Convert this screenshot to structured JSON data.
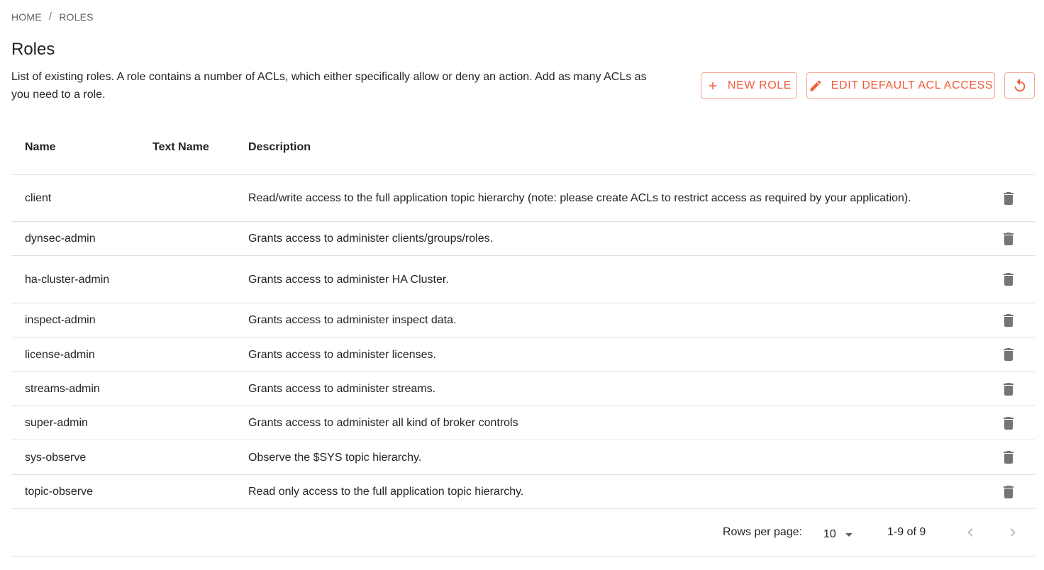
{
  "breadcrumb": {
    "home": "HOME",
    "separator": "/",
    "current": "ROLES"
  },
  "page": {
    "title": "Roles",
    "description": "List of existing roles. A role contains a number of ACLs, which either specifically allow or deny an action. Add as many ACLs as you need to a role."
  },
  "toolbar": {
    "new_role_label": "NEW ROLE",
    "edit_default_acl_label": "EDIT DEFAULT ACL ACCESS",
    "accent_color": "#f45b39"
  },
  "table": {
    "headers": {
      "name": "Name",
      "text_name": "Text Name",
      "description": "Description"
    },
    "rows": [
      {
        "name": "client",
        "text_name": "",
        "description": "Read/write access to the full application topic hierarchy (note: please create ACLs to restrict access as required by your application)."
      },
      {
        "name": "dynsec-admin",
        "text_name": "",
        "description": "Grants access to administer clients/groups/roles."
      },
      {
        "name": "ha-cluster-admin",
        "text_name": "",
        "description": "Grants access to administer HA Cluster."
      },
      {
        "name": "inspect-admin",
        "text_name": "",
        "description": "Grants access to administer inspect data."
      },
      {
        "name": "license-admin",
        "text_name": "",
        "description": "Grants access to administer licenses."
      },
      {
        "name": "streams-admin",
        "text_name": "",
        "description": "Grants access to administer streams."
      },
      {
        "name": "super-admin",
        "text_name": "",
        "description": "Grants access to administer all kind of broker controls"
      },
      {
        "name": "sys-observe",
        "text_name": "",
        "description": "Observe the $SYS topic hierarchy."
      },
      {
        "name": "topic-observe",
        "text_name": "",
        "description": "Read only access to the full application topic hierarchy."
      }
    ]
  },
  "pagination": {
    "rows_per_page_label": "Rows per page:",
    "rows_per_page_value": "10",
    "range": "1-9 of 9"
  }
}
